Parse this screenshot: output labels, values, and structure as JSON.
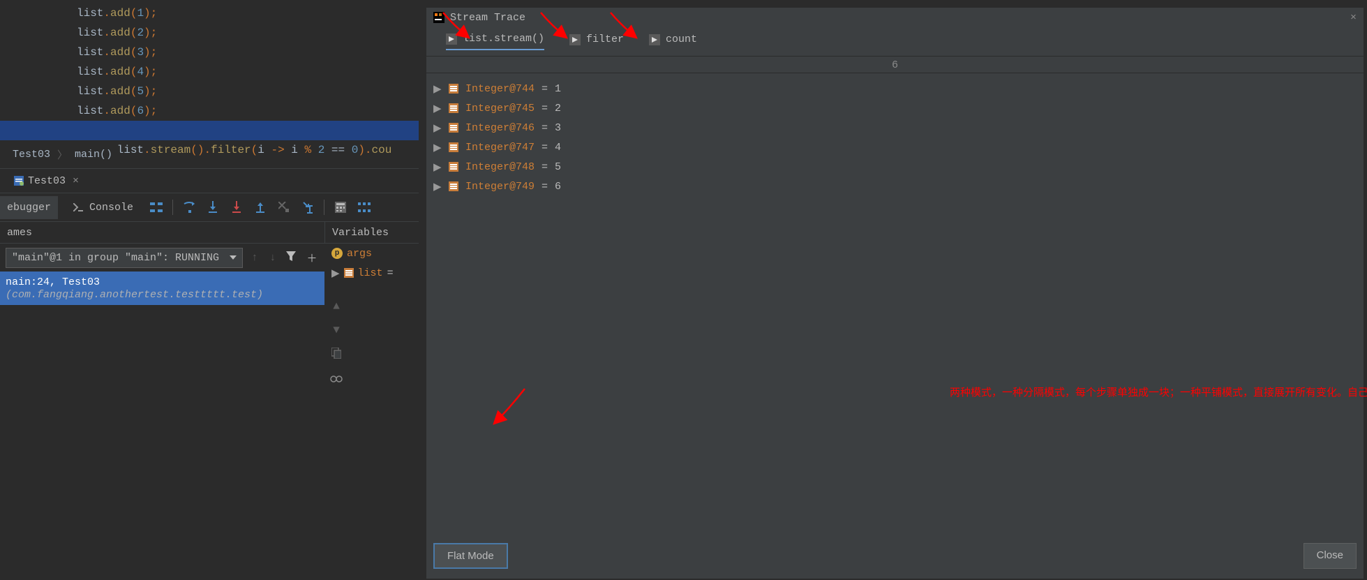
{
  "editor": {
    "lines": [
      {
        "indent": "        ",
        "obj": "list",
        "punc1": ".",
        "call": "add",
        "paren1": "(",
        "num": "1",
        "paren2": ")",
        "semi": ";"
      },
      {
        "indent": "        ",
        "obj": "list",
        "punc1": ".",
        "call": "add",
        "paren1": "(",
        "num": "2",
        "paren2": ")",
        "semi": ";"
      },
      {
        "indent": "        ",
        "obj": "list",
        "punc1": ".",
        "call": "add",
        "paren1": "(",
        "num": "3",
        "paren2": ")",
        "semi": ";"
      },
      {
        "indent": "        ",
        "obj": "list",
        "punc1": ".",
        "call": "add",
        "paren1": "(",
        "num": "4",
        "paren2": ")",
        "semi": ";"
      },
      {
        "indent": "        ",
        "obj": "list",
        "punc1": ".",
        "call": "add",
        "paren1": "(",
        "num": "5",
        "paren2": ")",
        "semi": ";"
      },
      {
        "indent": "        ",
        "obj": "list",
        "punc1": ".",
        "call": "add",
        "paren1": "(",
        "num": "6",
        "paren2": ")",
        "semi": ";"
      }
    ],
    "selected_line": "list.stream().filter(i -> i % 2 == 0).cou"
  },
  "breadcrumb": {
    "item0": "Test03",
    "item1": "main()"
  },
  "debug_tab": {
    "file": "Test03"
  },
  "tool_tabs": {
    "debugger": "ebugger",
    "console": "Console"
  },
  "panel_headers": {
    "frames": "ames",
    "vars": "Variables"
  },
  "thread": {
    "label": "\"main\"@1 in group \"main\": RUNNING"
  },
  "frame": {
    "prefix": "nain:24, Test03 ",
    "pkg": "(com.fangqiang.anothertest.testtttt.test)"
  },
  "vars": {
    "items": [
      {
        "icon": "p",
        "name": "args"
      },
      {
        "icon": "obj",
        "name": "list",
        "suffix": " ="
      }
    ]
  },
  "dialog": {
    "title": "Stream Trace",
    "tabs": [
      {
        "label": "list.stream()",
        "active": true
      },
      {
        "label": "filter",
        "active": false
      },
      {
        "label": "count",
        "active": false
      }
    ],
    "count": "6",
    "items": [
      {
        "name": "Integer@744",
        "val": "1"
      },
      {
        "name": "Integer@745",
        "val": "2"
      },
      {
        "name": "Integer@746",
        "val": "3"
      },
      {
        "name": "Integer@747",
        "val": "4"
      },
      {
        "name": "Integer@748",
        "val": "5"
      },
      {
        "name": "Integer@749",
        "val": "6"
      }
    ],
    "flat_mode": "Flat Mode",
    "close": "Close"
  },
  "annotation": "两种模式，一种分隔模式，每个步骤单独成一块；一种平铺模式，直接展开所有变化。自己试试就知道了。"
}
